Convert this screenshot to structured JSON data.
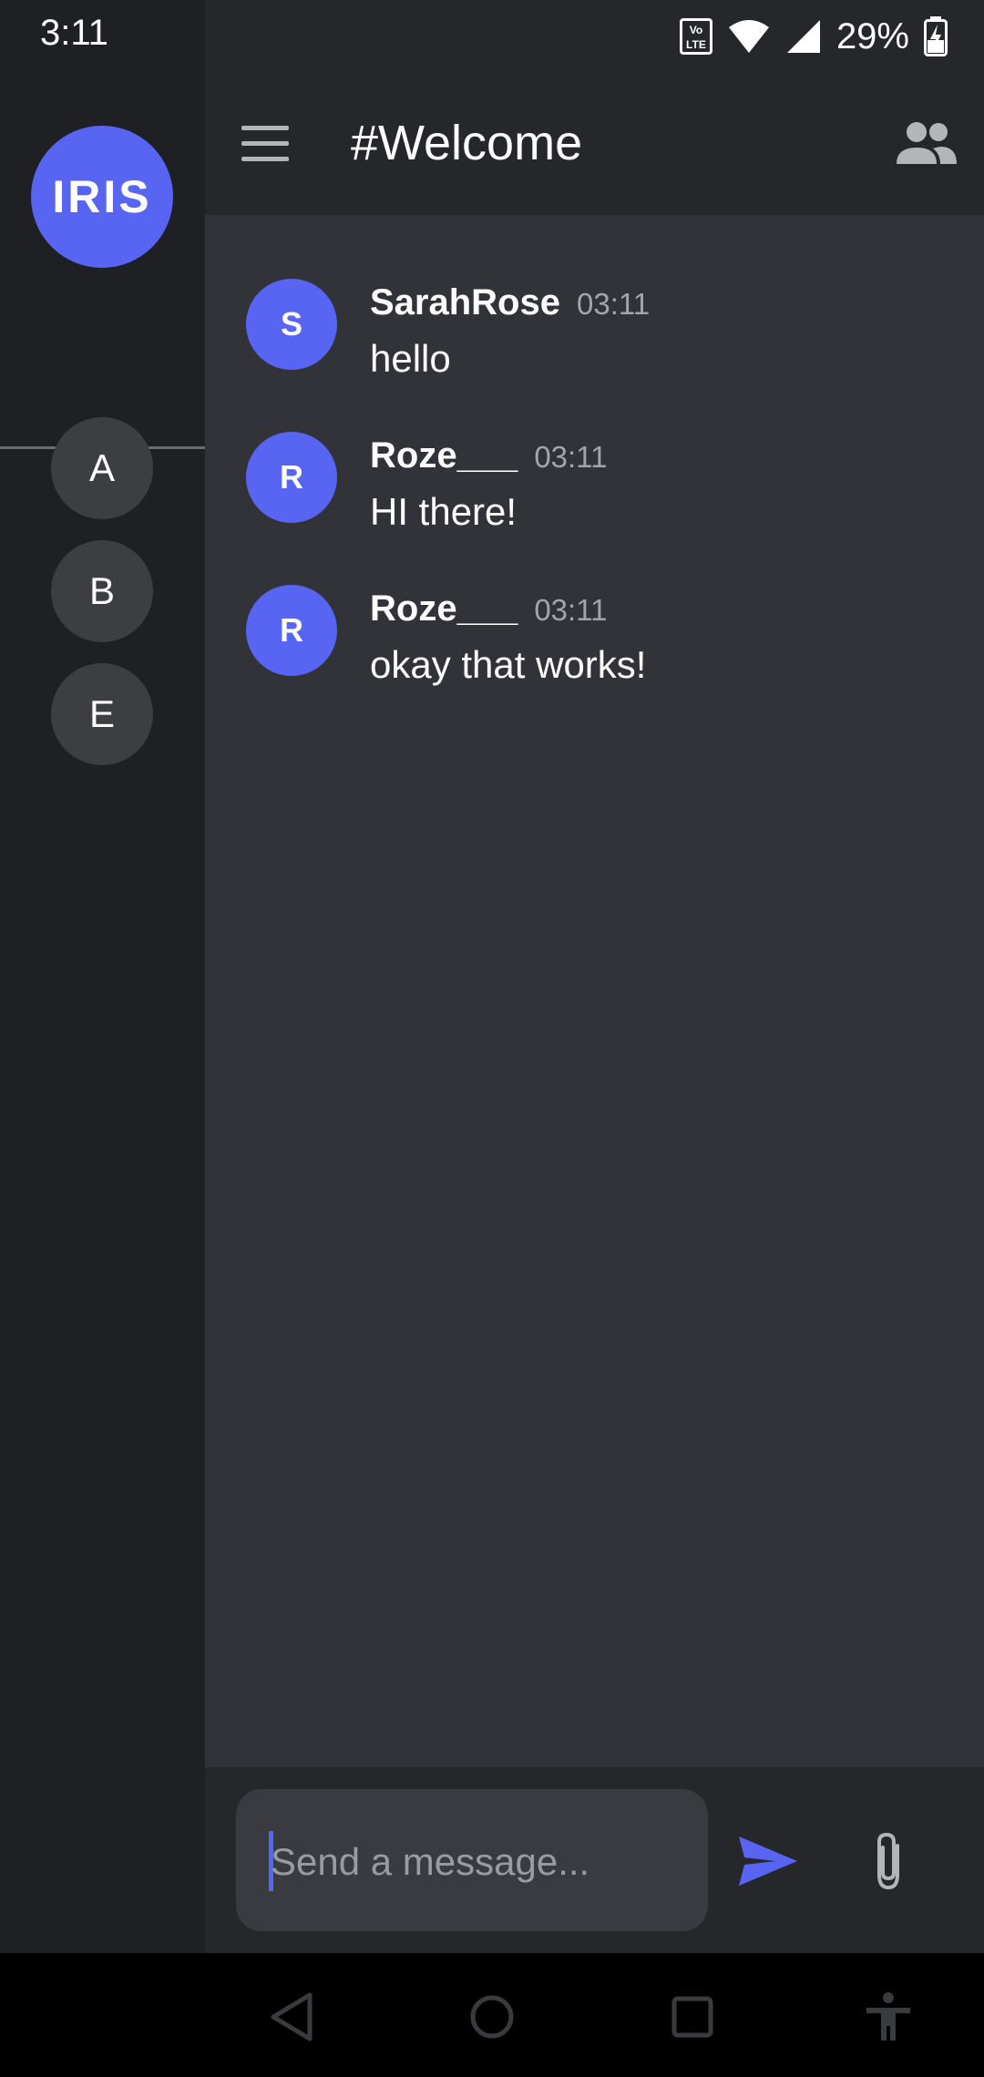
{
  "status_bar": {
    "time": "3:11",
    "volte": "Vo LTE",
    "battery_percent": "29%"
  },
  "sidebar": {
    "app_badge": "IRIS",
    "servers": [
      {
        "label": "A"
      },
      {
        "label": "B"
      },
      {
        "label": "E"
      }
    ]
  },
  "header": {
    "channel_title": "#Welcome"
  },
  "messages": [
    {
      "avatar": "S",
      "author": "SarahRose",
      "time": "03:11",
      "text": "hello"
    },
    {
      "avatar": "R",
      "author": "Roze___",
      "time": "03:11",
      "text": "HI there!"
    },
    {
      "avatar": "R",
      "author": "Roze___",
      "time": "03:11",
      "text": "okay that works!"
    }
  ],
  "composer": {
    "placeholder": "Send a message...",
    "value": ""
  },
  "colors": {
    "accent": "#5865f2",
    "background": "#323338",
    "rail": "#1f2024",
    "header": "#26272b"
  },
  "icons": {
    "menu": "hamburger-menu-icon",
    "members": "people-icon",
    "send": "send-icon",
    "attach": "paperclip-icon",
    "nav_back": "triangle-back-icon",
    "nav_home": "circle-home-icon",
    "nav_recents": "square-recents-icon",
    "nav_accessibility": "accessibility-icon"
  }
}
